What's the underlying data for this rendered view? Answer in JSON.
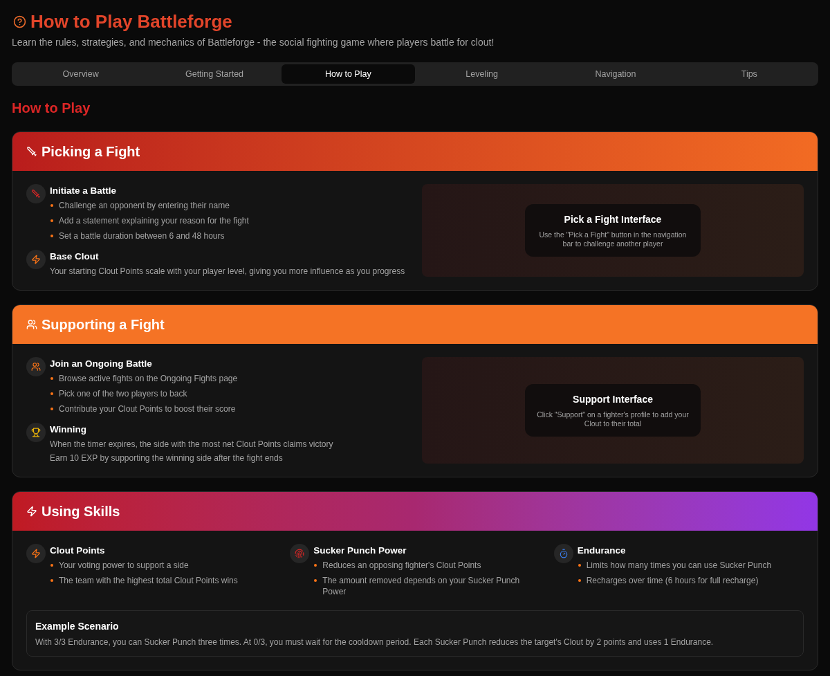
{
  "header": {
    "title": "How to Play Battleforge",
    "subtitle": "Learn the rules, strategies, and mechanics of Battleforge - the social fighting game where players battle for clout!"
  },
  "tabs": [
    {
      "label": "Overview",
      "selected": false
    },
    {
      "label": "Getting Started",
      "selected": false
    },
    {
      "label": "How to Play",
      "selected": true
    },
    {
      "label": "Leveling",
      "selected": false
    },
    {
      "label": "Navigation",
      "selected": false
    },
    {
      "label": "Tips",
      "selected": false
    }
  ],
  "section_title": "How to Play",
  "cards": [
    {
      "kind": "split",
      "title": "Picking a Fight",
      "items": [
        {
          "kind": "bullets",
          "title": "Initiate a Battle",
          "lines": [
            "Challenge an opponent by entering their name",
            "Add a statement explaining your reason for the fight",
            "Set a battle duration between 6 and 48 hours"
          ]
        },
        {
          "kind": "text",
          "title": "Base Clout",
          "lines": [
            "Your starting Clout Points scale with your player level, giving you more influence as you progress"
          ]
        }
      ],
      "preview": {
        "title": "Pick a Fight Interface",
        "text": "Use the \"Pick a Fight\" button in the navigation bar to challenge another player"
      }
    },
    {
      "kind": "split",
      "title": "Supporting a Fight",
      "items": [
        {
          "kind": "bullets",
          "title": "Join an Ongoing Battle",
          "lines": [
            "Browse active fights on the Ongoing Fights page",
            "Pick one of the two players to back",
            "Contribute your Clout Points to boost their score"
          ]
        },
        {
          "kind": "text",
          "title": "Winning",
          "lines": [
            "When the timer expires, the side with the most net Clout Points claims victory",
            "Earn 10 EXP by supporting the winning side after the fight ends"
          ]
        }
      ],
      "preview": {
        "title": "Support Interface",
        "text": "Click \"Support\" on a fighter's profile to add your Clout to their total"
      }
    },
    {
      "kind": "grid",
      "title": "Using Skills",
      "items": [
        {
          "kind": "bullets",
          "title": "Clout Points",
          "lines": [
            "Your voting power to support a side",
            "The team with the highest total Clout Points wins"
          ]
        },
        {
          "kind": "bullets",
          "title": "Sucker Punch Power",
          "lines": [
            "Reduces an opposing fighter's Clout Points",
            "The amount removed depends on your Sucker Punch Power"
          ]
        },
        {
          "kind": "bullets",
          "title": "Endurance",
          "lines": [
            "Limits how many times you can use Sucker Punch",
            "Recharges over time (6 hours for full recharge)"
          ]
        }
      ],
      "example": {
        "title": "Example Scenario",
        "text": "With 3/3 Endurance, you can Sucker Punch three times. At 0/3, you must wait for the cooldown period. Each Sucker Punch reduces the target's Clout by 2 points and uses 1 Endurance."
      }
    }
  ]
}
